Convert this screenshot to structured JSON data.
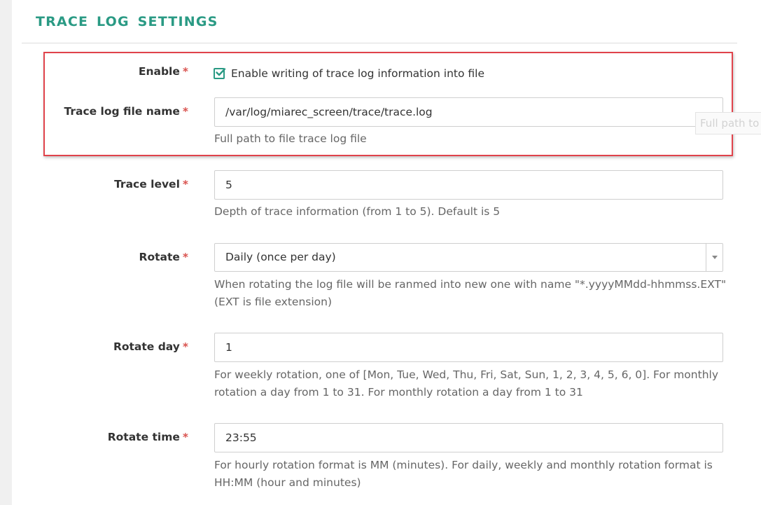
{
  "section": {
    "title": "TRACE LOG SETTINGS"
  },
  "required_marker": "*",
  "fields": {
    "enable": {
      "label": "Enable",
      "checked": true,
      "checkbox_label": "Enable writing of trace log information into file"
    },
    "trace_log_file_name": {
      "label": "Trace log file name",
      "value": "/var/log/miarec_screen/trace/trace.log",
      "help": "Full path to file trace log file",
      "tooltip": "Full path to"
    },
    "trace_level": {
      "label": "Trace level",
      "value": "5",
      "help": "Depth of trace information (from 1 to 5). Default is 5"
    },
    "rotate": {
      "label": "Rotate",
      "value": "Daily (once per day)",
      "help_line1": "When rotating the log file will be ranmed into new one with name \"*.yyyyMMdd-hhmmss.EXT\"",
      "help_line2": "(EXT is file extension)"
    },
    "rotate_day": {
      "label": "Rotate day",
      "value": "1",
      "help_line1": "For weekly rotation, one of [Mon, Tue, Wed, Thu, Fri, Sat, Sun, 1, 2, 3, 4, 5, 6, 0]. For monthly",
      "help_line2": "rotation a day from 1 to 31. For monthly rotation a day from 1 to 31"
    },
    "rotate_time": {
      "label": "Rotate time",
      "value": "23:55",
      "help_line1": "For hourly rotation format is MM (minutes). For daily, weekly and monthly rotation format is",
      "help_line2": "HH:MM (hour and minutes)"
    }
  },
  "colors": {
    "accent": "#2a9a84",
    "required": "#d9534f",
    "highlight": "#e0434b"
  },
  "icons": {
    "checkbox": "check-square-icon",
    "select_arrow": "caret-down-icon"
  }
}
